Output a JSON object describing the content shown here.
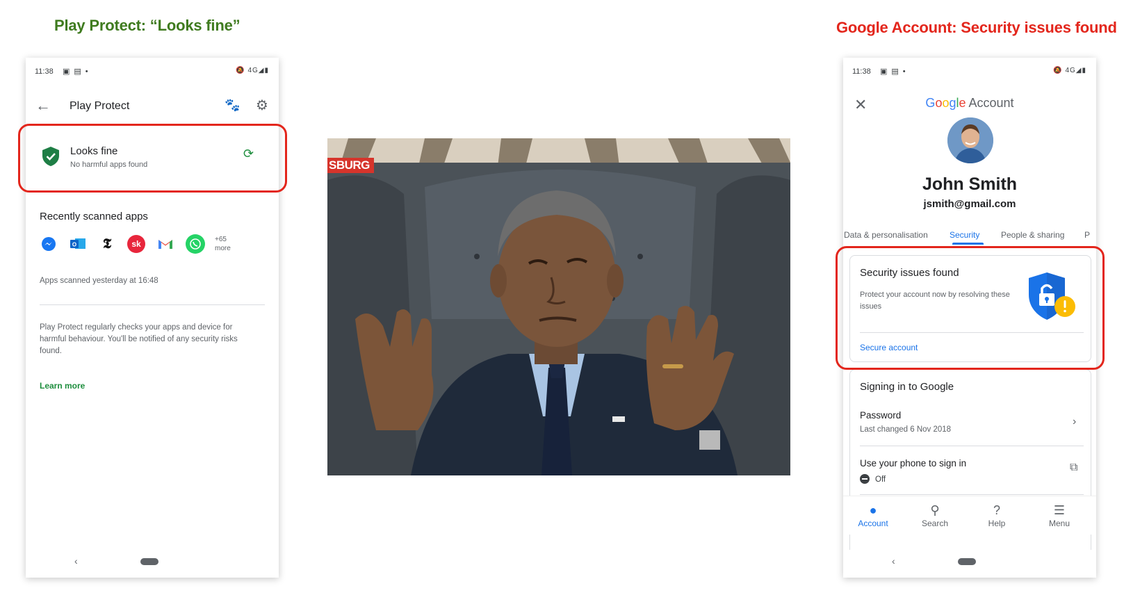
{
  "captions": {
    "left": "Play Protect: “Looks fine”",
    "right": "Google Account: Security issues found"
  },
  "colors": {
    "caption_left": "#3f7b1f",
    "caption_right": "#e3261c",
    "highlight_box": "#e3261c",
    "play_green": "#1e8e3e",
    "google_blue": "#1a73e8"
  },
  "left_phone": {
    "status_bar": {
      "time": "11:38",
      "network": "4G"
    },
    "app_bar": {
      "title": "Play Protect"
    },
    "status_card": {
      "title": "Looks fine",
      "subtitle": "No harmful apps found"
    },
    "recent": {
      "title": "Recently scanned apps",
      "apps": [
        {
          "icon": "messenger-icon",
          "glyph": "✉",
          "color": "#1877f2"
        },
        {
          "icon": "outlook-icon",
          "glyph": "O",
          "color": "#0a64c8"
        },
        {
          "icon": "nytimes-icon",
          "glyph": "𝕿",
          "color": "#ffffff"
        },
        {
          "icon": "sk-icon",
          "glyph": "sk",
          "color": "#e8263c"
        },
        {
          "icon": "gmail-icon",
          "glyph": "M",
          "color": "#ffffff"
        },
        {
          "icon": "whatsapp-icon",
          "glyph": "✆",
          "color": "#25d366"
        }
      ],
      "more_count": "+65",
      "more_label": "more"
    },
    "scanned_text": "Apps scanned yesterday at 16:48",
    "description": "Play Protect regularly checks your apps and device for harmful behaviour. You'll be notified of any security risks found.",
    "learn_more": "Learn more"
  },
  "meme": {
    "overlay_text": "SBURG"
  },
  "right_phone": {
    "status_bar": {
      "time": "11:38",
      "network": "4G"
    },
    "header": {
      "brand": "Google",
      "product": "Account"
    },
    "profile": {
      "name": "John Smith",
      "email": "jsmith@gmail.com"
    },
    "tabs": [
      {
        "label": "Data & personalisation",
        "active": false
      },
      {
        "label": "Security",
        "active": true
      },
      {
        "label": "People & sharing",
        "active": false
      },
      {
        "label": "P",
        "active": false
      }
    ],
    "security_card": {
      "title": "Security issues found",
      "subtitle": "Protect your account now by resolving these issues",
      "action": "Secure account"
    },
    "signin_card": {
      "title": "Signing in to Google",
      "password_label": "Password",
      "password_sub": "Last changed 6 Nov 2018",
      "phone_label": "Use your phone to sign in",
      "phone_status": "Off"
    },
    "bottom_nav": [
      {
        "label": "Account",
        "icon": "account-icon",
        "active": true
      },
      {
        "label": "Search",
        "icon": "search-icon",
        "active": false
      },
      {
        "label": "Help",
        "icon": "help-icon",
        "active": false
      },
      {
        "label": "Menu",
        "icon": "menu-icon",
        "active": false
      }
    ]
  }
}
